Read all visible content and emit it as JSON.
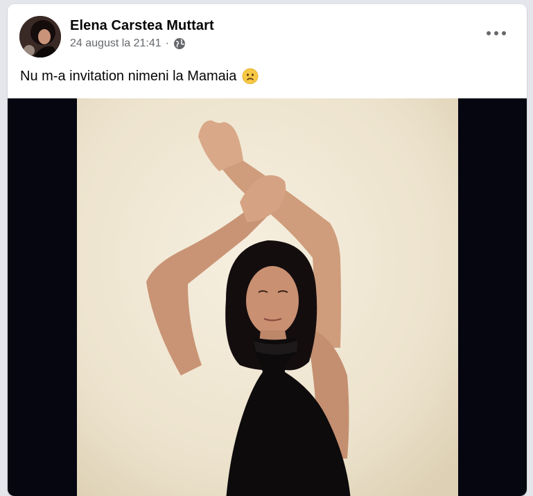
{
  "post": {
    "author": "Elena Carstea Muttart",
    "timestamp": "24 august la 21:41",
    "separator": "·",
    "audience_icon": "globe-icon",
    "text": "Nu m-a invitation nimeni la Mamaia",
    "emoji": "worried-face-emoji",
    "more_icon": "more-options-icon",
    "colors": {
      "name": "#050505",
      "meta": "#65676b",
      "media_background": "#060611",
      "photo_wall": "#efe6d2"
    }
  }
}
